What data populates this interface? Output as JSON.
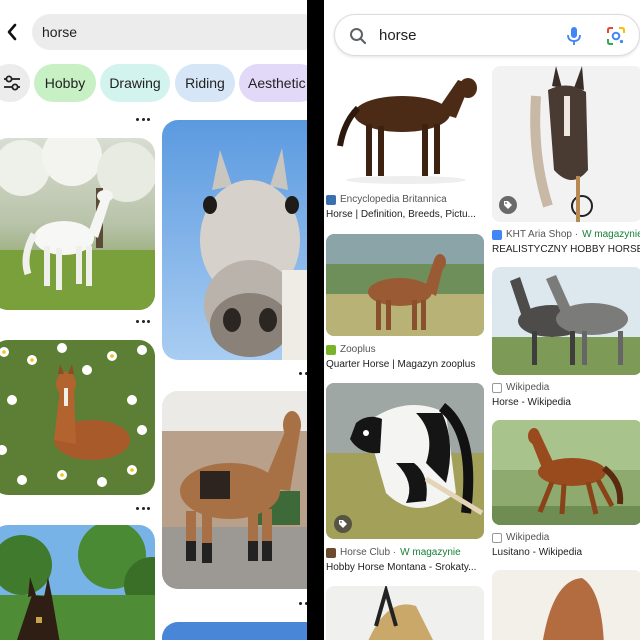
{
  "left": {
    "search_query": "horse",
    "chips": [
      {
        "label": "Hobby",
        "color": "#c7f0c4"
      },
      {
        "label": "Drawing",
        "color": "#d3f3ee"
      },
      {
        "label": "Riding",
        "color": "#d6e6f7"
      },
      {
        "label": "Aesthetic",
        "color": "#e2d9f8"
      }
    ],
    "pins": [
      {
        "name": "pin-white-horse-blossoms",
        "alt": "White horse under blossoming trees"
      },
      {
        "name": "pin-grey-horse-closeup",
        "alt": "Grey horse face close-up against sky"
      },
      {
        "name": "pin-foal-daisies",
        "alt": "Chestnut foal lying among daisies"
      },
      {
        "name": "pin-horse-saddled",
        "alt": "Saddled brown horse in a yard"
      },
      {
        "name": "pin-horse-trees",
        "alt": "Horse in front of trees"
      },
      {
        "name": "pin-bottom",
        "alt": "Horse image"
      }
    ]
  },
  "right": {
    "search_query": "horse",
    "results": [
      {
        "source": "Encyclopedia Britannica",
        "store": "",
        "title": "Horse | Definition, Breeds, Pictu..."
      },
      {
        "source": "KHT Aria Shop · ",
        "store": "W magazynie",
        "title": "REALISTYCZNY HOBBY HORSE ..."
      },
      {
        "source": "Zooplus",
        "store": "",
        "title": "Quarter Horse | Magazyn zooplus"
      },
      {
        "source": "Wikipedia",
        "store": "",
        "title": "Horse - Wikipedia"
      },
      {
        "source": "Horse Club · ",
        "store": "W magazynie",
        "title": "Hobby Horse Montana - Srokaty..."
      },
      {
        "source": "Wikipedia",
        "store": "",
        "title": "Lusitano - Wikipedia"
      }
    ]
  },
  "colors": {
    "google_blue": "#4285f4",
    "google_red": "#ea4335",
    "google_yellow": "#fbbc05",
    "google_green": "#34a853",
    "in_stock_green": "#188038"
  }
}
